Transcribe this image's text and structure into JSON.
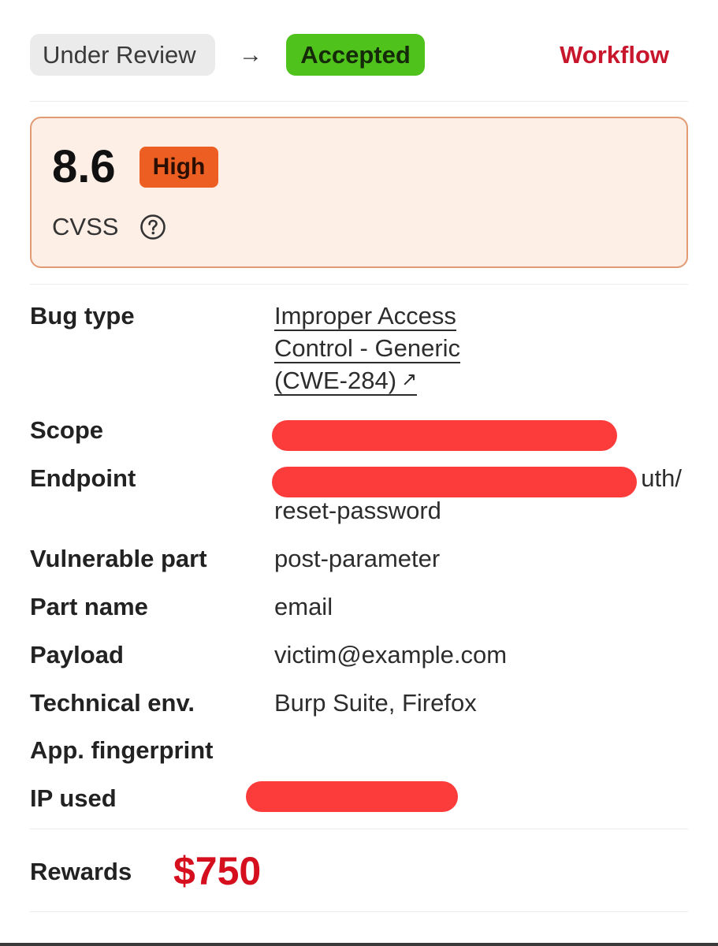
{
  "workflow": {
    "from_status": "Under Review",
    "arrow": "→",
    "to_status": "Accepted",
    "link_label": "Workflow",
    "colors": {
      "to_status_bg": "#4fc21c",
      "link": "#c8162c"
    }
  },
  "cvss": {
    "score": "8.6",
    "severity": "High",
    "label": "CVSS",
    "help_icon": "question-circle-icon",
    "colors": {
      "card_bg": "#fdeee6",
      "card_border": "#e29a72",
      "badge_bg": "#ed5e22"
    }
  },
  "details": {
    "bug_type": {
      "label": "Bug type",
      "lines": [
        "Improper Access",
        "Control - Generic",
        "(CWE-284)"
      ],
      "external_icon": "external-link-icon"
    },
    "scope": {
      "label": "Scope"
    },
    "endpoint": {
      "label": "Endpoint",
      "visible_suffix": "uth/",
      "line2": "reset-password"
    },
    "vulnerable_part": {
      "label": "Vulnerable part",
      "value": "post-parameter"
    },
    "part_name": {
      "label": "Part name",
      "value": "email"
    },
    "payload": {
      "label": "Payload",
      "value": "victim@example.com"
    },
    "technical_env": {
      "label": "Technical env.",
      "value": "Burp Suite, Firefox"
    },
    "app_fingerprint": {
      "label": "App. fingerprint"
    },
    "ip_used": {
      "label": "IP used"
    },
    "redaction_color": "#fc3b3b"
  },
  "rewards": {
    "label": "Rewards",
    "value": "$750",
    "color": "#d60f1f"
  }
}
